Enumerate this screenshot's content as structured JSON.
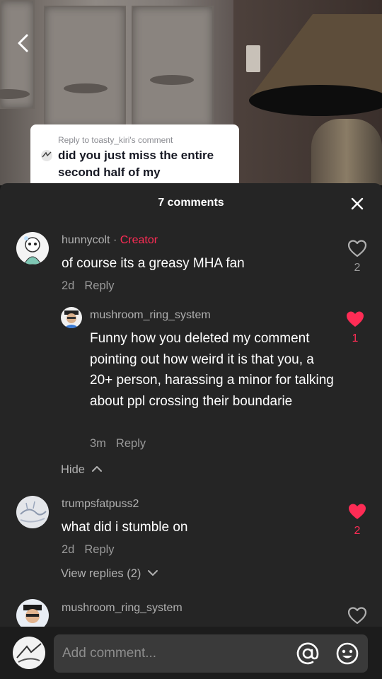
{
  "reply_card": {
    "reply_to": "Reply to toasty_kiri's comment",
    "text": "did you just miss the entire second half of my"
  },
  "sheet": {
    "title": "7 comments"
  },
  "comments": [
    {
      "username": "hunnycolt",
      "separator": " · ",
      "creator_label": "Creator",
      "text": "of course its a greasy MHA fan",
      "time": "2d",
      "reply_label": "Reply",
      "likes": "2",
      "liked": false
    },
    {
      "username": "mushroom_ring_system",
      "text": "Funny how you deleted my comment pointing out how weird it is that you, a 20+ person, harassing a minor for talking about ppl crossing their boundarie",
      "time": "3m",
      "reply_label": "Reply",
      "likes": "1",
      "liked": true
    },
    {
      "username": "trumpsfatpuss2",
      "text": "what did i stumble on",
      "time": "2d",
      "reply_label": "Reply",
      "likes": "2",
      "liked": true
    },
    {
      "username": "mushroom_ring_system",
      "liked": false
    }
  ],
  "hide_label": "Hide",
  "view_replies_label": "View replies (2)",
  "input": {
    "placeholder": "Add comment..."
  },
  "colors": {
    "accent": "#fe2c55",
    "sheet_bg": "#252525",
    "input_bg": "#3a3a3a"
  },
  "icons": [
    "back-arrow-icon",
    "close-icon",
    "heart-icon",
    "heart-filled-icon",
    "chevron-up-icon",
    "chevron-down-icon",
    "at-sign-icon",
    "emoji-icon"
  ]
}
